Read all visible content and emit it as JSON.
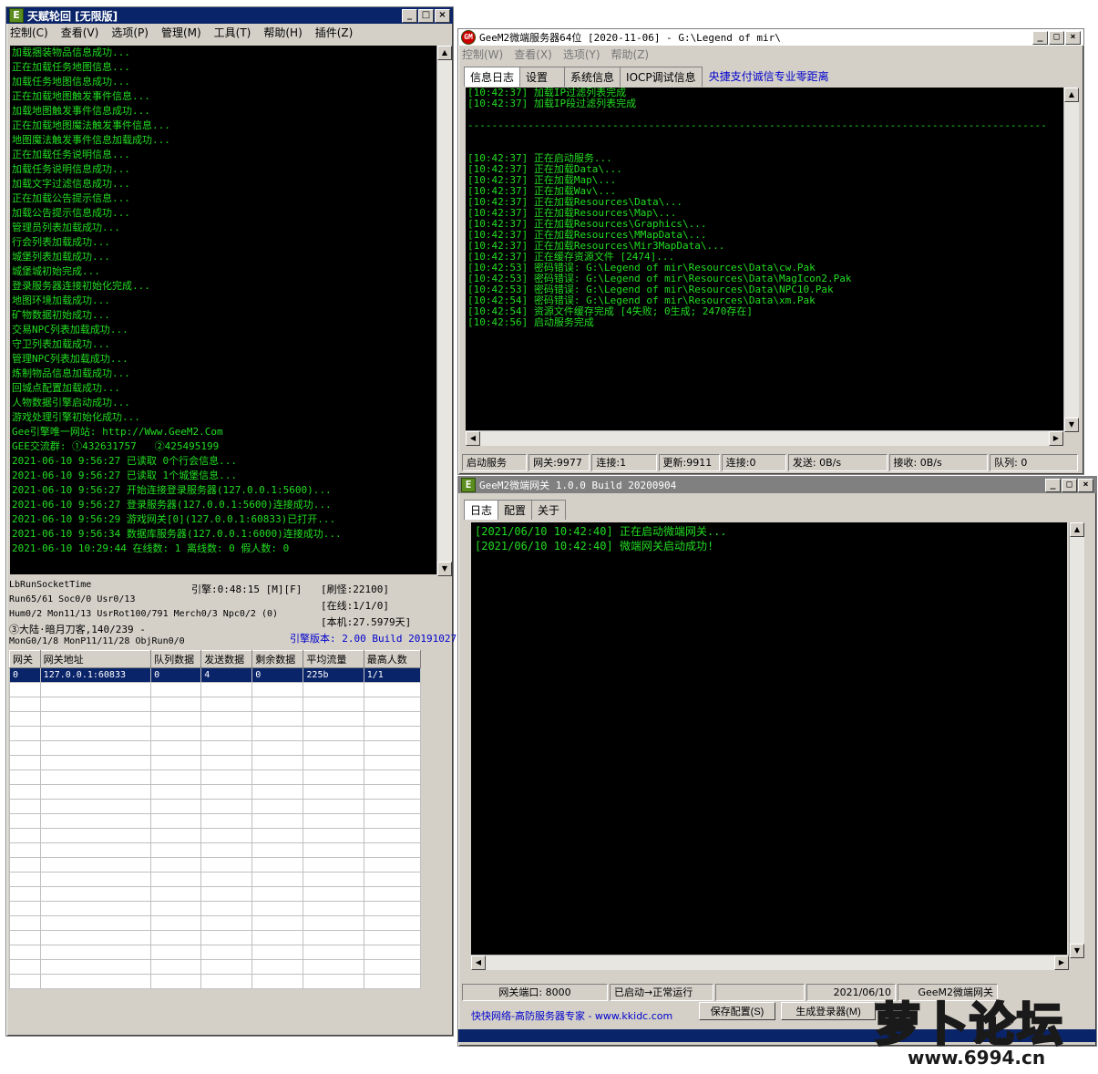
{
  "win1": {
    "title": "天赋轮回 [无限版]",
    "menu": [
      "控制(C)",
      "查看(V)",
      "选项(P)",
      "管理(M)",
      "工具(T)",
      "帮助(H)",
      "插件(Z)"
    ],
    "log": [
      "加载捆装物品信息成功...",
      "正在加载任务地图信息...",
      "加载任务地图信息成功...",
      "正在加载地图触发事件信息...",
      "加载地图触发事件信息成功...",
      "正在加载地图魔法触发事件信息...",
      "地图魔法触发事件信息加载成功...",
      "正在加载任务说明信息...",
      "加载任务说明信息成功...",
      "加载文字过滤信息成功...",
      "正在加载公告提示信息...",
      "加载公告提示信息成功...",
      "管理员列表加载成功...",
      "行会列表加载成功...",
      "城堡列表加载成功...",
      "城堡城初始完成...",
      "登录服务器连接初始化完成...",
      "地图环境加载成功...",
      "矿物数据初始成功...",
      "交易NPC列表加载成功...",
      "守卫列表加载成功...",
      "管理NPC列表加载成功...",
      "炼制物品信息加载成功...",
      "回城点配置加载成功...",
      "人物数据引擎启动成功...",
      "游戏处理引擎初始化成功...",
      "Gee引擎唯一网站: http://Www.GeeM2.Com",
      "GEE交流群: ①432631757   ②425495199",
      "2021-06-10 9:56:27 已读取 0个行会信息...",
      "2021-06-10 9:56:27 已读取 1个城堡信息...",
      "2021-06-10 9:56:27 开始连接登录服务器(127.0.0.1:5600)...",
      "2021-06-10 9:56:27 登录服务器(127.0.0.1:5600)连接成功...",
      "2021-06-10 9:56:29 游戏网关[0](127.0.0.1:60833)已打开...",
      "2021-06-10 9:56:34 数据库服务器(127.0.0.1:6000)连接成功...",
      "2021-06-10 10:29:44 在线数: 1 离线数: 0 假人数: 0"
    ],
    "info": {
      "l1": "LbRunSocketTime",
      "l2": "Run65/61 Soc0/0 Usr0/13",
      "l3": "Hum0/2 Mon11/13 UsrRot100/791 Merch0/3 Npc0/2 (0)",
      "l4": "③大陆·暗月刀客,140/239 -",
      "l5": "MonG0/1/8 MonP11/11/28 ObjRun0/0",
      "engine_time": "引擎:0:48:15 [M][F]",
      "refresh": "[刷怪:22100]",
      "online": "[在线:1/1/0]",
      "local": "[本机:27.5979天]",
      "version": "引擎版本: 2.00 Build 20191027"
    },
    "table": {
      "headers": [
        "网关",
        "网关地址",
        "队列数据",
        "发送数据",
        "剩余数据",
        "平均流量",
        "最高人数"
      ],
      "row": [
        "0",
        "127.0.0.1:60833",
        "0",
        "4",
        "0",
        "225b",
        "1/1"
      ]
    }
  },
  "win2": {
    "title": "GeeM2微端服务器64位 [2020-11-06] - G:\\Legend of mir\\",
    "menu": [
      "控制(W)",
      "查看(X)",
      "选项(Y)",
      "帮助(Z)"
    ],
    "tabs": [
      "信息日志",
      "设置",
      "系统信息",
      "IOCP调试信息"
    ],
    "ad": "央捷支付诚信专业零距离",
    "log": [
      "[10:42:37] 加载IP过滤列表完成",
      "[10:42:37] 加载IP段过滤列表完成",
      "",
      "------------------------------------------------------------------------------------------------",
      "",
      "",
      "[10:42:37] 正在启动服务...",
      "[10:42:37] 正在加载Data\\...",
      "[10:42:37] 正在加载Map\\...",
      "[10:42:37] 正在加载Wav\\...",
      "[10:42:37] 正在加载Resources\\Data\\...",
      "[10:42:37] 正在加载Resources\\Map\\...",
      "[10:42:37] 正在加载Resources\\Graphics\\...",
      "[10:42:37] 正在加载Resources\\MMapData\\...",
      "[10:42:37] 正在加载Resources\\Mir3MapData\\...",
      "[10:42:37] 正在缓存资源文件 [2474]...",
      "[10:42:53] 密码错误: G:\\Legend of mir\\Resources\\Data\\cw.Pak",
      "[10:42:53] 密码错误: G:\\Legend of mir\\Resources\\Data\\MagIcon2.Pak",
      "[10:42:53] 密码错误: G:\\Legend of mir\\Resources\\Data\\NPC10.Pak",
      "[10:42:54] 密码错误: G:\\Legend of mir\\Resources\\Data\\xm.Pak",
      "[10:42:54] 资源文件缓存完成 [4失败; 0生成; 2470存在]",
      "[10:42:56] 启动服务完成"
    ],
    "status": [
      "启动服务",
      "网关:9977",
      "连接:1",
      "更新:9911",
      "连接:0",
      "发送: 0B/s",
      "接收: 0B/s",
      "队列: 0"
    ]
  },
  "win3": {
    "title": "GeeM2微端网关 1.0.0 Build 20200904",
    "tabs": [
      "日志",
      "配置",
      "关于"
    ],
    "log": [
      "[2021/06/10 10:42:40] 正在启动微端网关...",
      "[2021/06/10 10:42:40] 微端网关启动成功!"
    ],
    "status": [
      "网关端口: 8000",
      "已启动→正常运行",
      "",
      "2021/06/10",
      "GeeM2微端网关"
    ],
    "footer_link": "快快网络-高防服务器专家 - www.kkidc.com",
    "btn_save": "保存配置(S)",
    "btn_gen": "生成登录器(M)"
  },
  "watermark": {
    "brand": "萝卜论坛",
    "url": "www.6994.cn"
  },
  "icons": {
    "app": "E",
    "app_red": "GM"
  }
}
